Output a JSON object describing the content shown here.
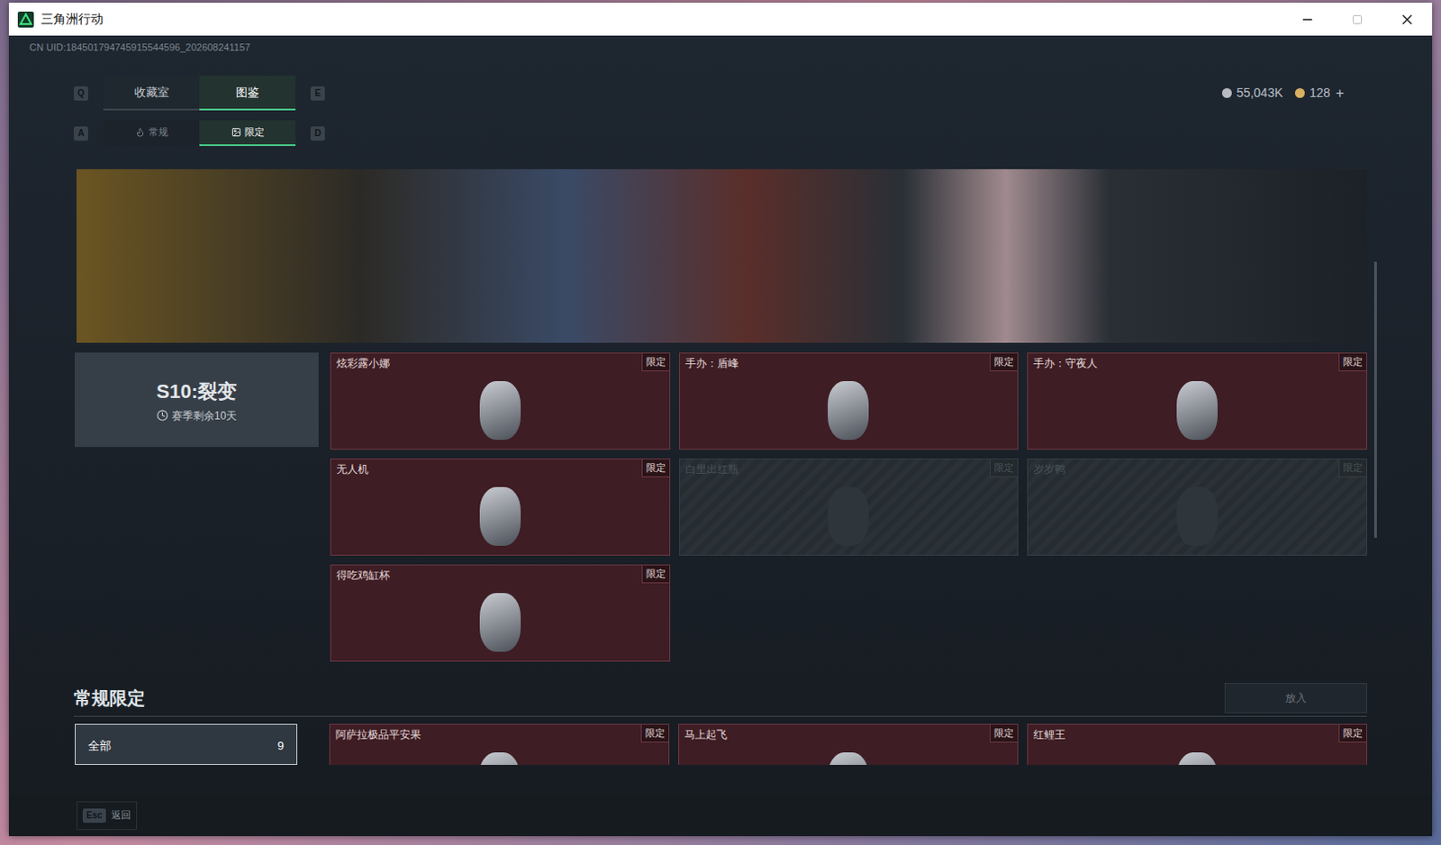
{
  "window": {
    "title": "三角洲行动"
  },
  "uid": "CN UID:184501794745915544596_202608241157",
  "currencies": [
    {
      "amount": "55,043K",
      "color": "#b8bcc0"
    },
    {
      "amount": "128",
      "color": "#d8b060"
    }
  ],
  "currency_add": "+",
  "main_tabs": {
    "prev_key": "Q",
    "next_key": "E",
    "tabs": [
      {
        "label": "收藏室",
        "selected": false
      },
      {
        "label": "图鉴",
        "selected": true
      }
    ]
  },
  "sub_tabs": {
    "prev_key": "A",
    "next_key": "D",
    "tabs": [
      {
        "label": "常规",
        "selected": false
      },
      {
        "label": "限定",
        "selected": true
      }
    ]
  },
  "season": {
    "title": "S10:裂变",
    "remaining": "赛季剩余10天"
  },
  "season_items": [
    {
      "name": "炫彩露小娜",
      "badge": "限定",
      "collected": true
    },
    {
      "name": "手办：盾峰",
      "badge": "限定",
      "collected": true
    },
    {
      "name": "手办：守夜人",
      "badge": "限定",
      "collected": true
    },
    {
      "name": "无人机",
      "badge": "限定",
      "collected": true
    },
    {
      "name": "白里出红瓶",
      "badge": "限定",
      "collected": false
    },
    {
      "name": "岁岁鸭",
      "badge": "限定",
      "collected": false
    },
    {
      "name": "得吃鸡缸杯",
      "badge": "限定",
      "collected": true
    }
  ],
  "section": {
    "title": "常规限定",
    "button": {
      "label": "放入",
      "disabled": true
    }
  },
  "filters": [
    {
      "label": "全部",
      "count": "9",
      "selected": true
    }
  ],
  "regular_items": [
    {
      "name": "阿萨拉极品平安果",
      "badge": "限定",
      "collected": true
    },
    {
      "name": "马上起飞",
      "badge": "限定",
      "collected": true
    },
    {
      "name": "红鲤王",
      "badge": "限定",
      "collected": true
    }
  ],
  "footer": {
    "key": "Esc",
    "label": "返回"
  }
}
